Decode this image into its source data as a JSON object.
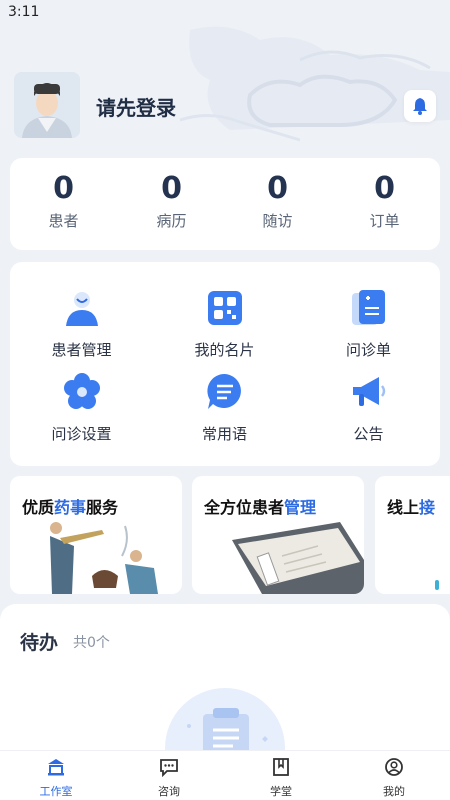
{
  "status_bar": {
    "time": "3:11"
  },
  "header": {
    "login_prompt": "请先登录"
  },
  "stats": [
    {
      "value": "0",
      "label": "患者"
    },
    {
      "value": "0",
      "label": "病历"
    },
    {
      "value": "0",
      "label": "随访"
    },
    {
      "value": "0",
      "label": "订单"
    }
  ],
  "menu": [
    {
      "label": "患者管理",
      "icon": "patient-icon"
    },
    {
      "label": "我的名片",
      "icon": "qr-card-icon"
    },
    {
      "label": "问诊单",
      "icon": "consult-form-icon"
    },
    {
      "label": "问诊设置",
      "icon": "settings-flower-icon"
    },
    {
      "label": "常用语",
      "icon": "chat-phrase-icon"
    },
    {
      "label": "公告",
      "icon": "megaphone-icon"
    }
  ],
  "banners": [
    {
      "prefix": "优质",
      "highlight": "药事",
      "suffix": "服务"
    },
    {
      "prefix": "全方位患者",
      "highlight": "管理",
      "suffix": ""
    },
    {
      "prefix": "线上",
      "highlight": "接",
      "suffix": ""
    }
  ],
  "todo": {
    "title": "待办",
    "count": "共0个"
  },
  "tabbar": [
    {
      "label": "工作室",
      "icon": "studio-icon",
      "active": true
    },
    {
      "label": "咨询",
      "icon": "message-icon",
      "active": false
    },
    {
      "label": "学堂",
      "icon": "bookmark-icon",
      "active": false
    },
    {
      "label": "我的",
      "icon": "profile-icon",
      "active": false
    }
  ],
  "colors": {
    "accent": "#2d6be3",
    "background": "#eef1f6",
    "card": "#ffffff",
    "text_dark": "#1f2d45"
  }
}
